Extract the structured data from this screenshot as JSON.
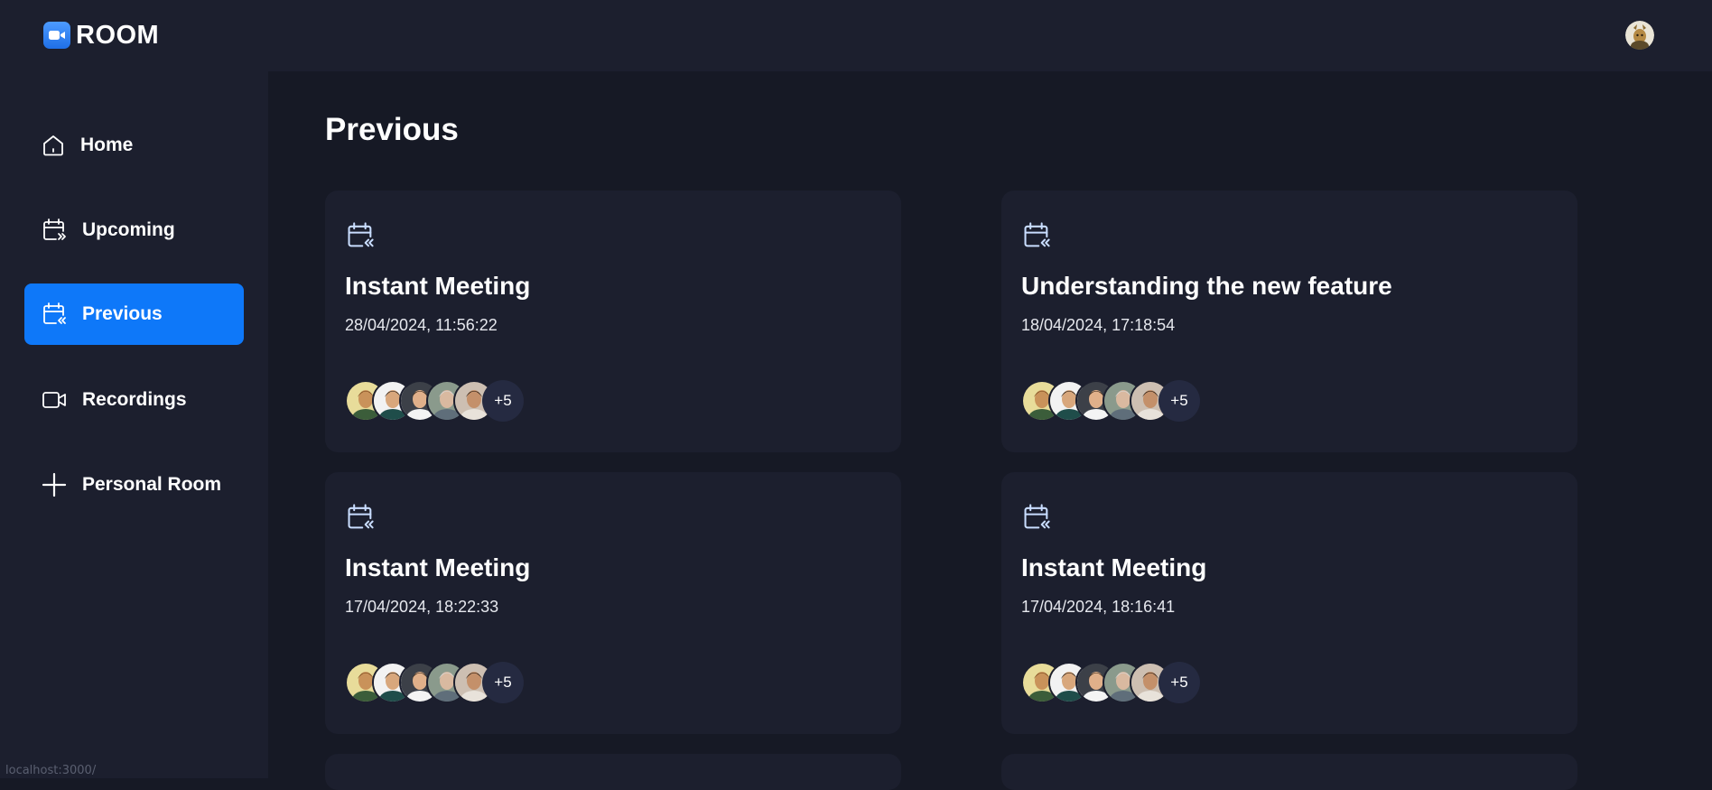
{
  "app": {
    "logo_text": "ROOM"
  },
  "sidebar": {
    "items": [
      {
        "label": "Home",
        "icon": "home-icon",
        "active": false
      },
      {
        "label": "Upcoming",
        "icon": "calendar-forward-icon",
        "active": false
      },
      {
        "label": "Previous",
        "icon": "calendar-back-icon",
        "active": true
      },
      {
        "label": "Recordings",
        "icon": "video-icon",
        "active": false
      },
      {
        "label": "Personal Room",
        "icon": "plus-icon",
        "active": false
      }
    ]
  },
  "main": {
    "title": "Previous",
    "meetings": [
      {
        "title": "Instant Meeting",
        "date": "28/04/2024, 11:56:22",
        "more_attendees": "+5"
      },
      {
        "title": "Understanding the new feature",
        "date": "18/04/2024, 17:18:54",
        "more_attendees": "+5"
      },
      {
        "title": "Instant Meeting",
        "date": "17/04/2024, 18:22:33",
        "more_attendees": "+5"
      },
      {
        "title": "Instant Meeting",
        "date": "17/04/2024, 18:16:41",
        "more_attendees": "+5"
      }
    ]
  },
  "status_bar": {
    "url": "localhost:3000/"
  },
  "colors": {
    "background": "#161925",
    "panel": "#1c1f2e",
    "accent": "#0e78f9",
    "badge": "#252a41"
  }
}
